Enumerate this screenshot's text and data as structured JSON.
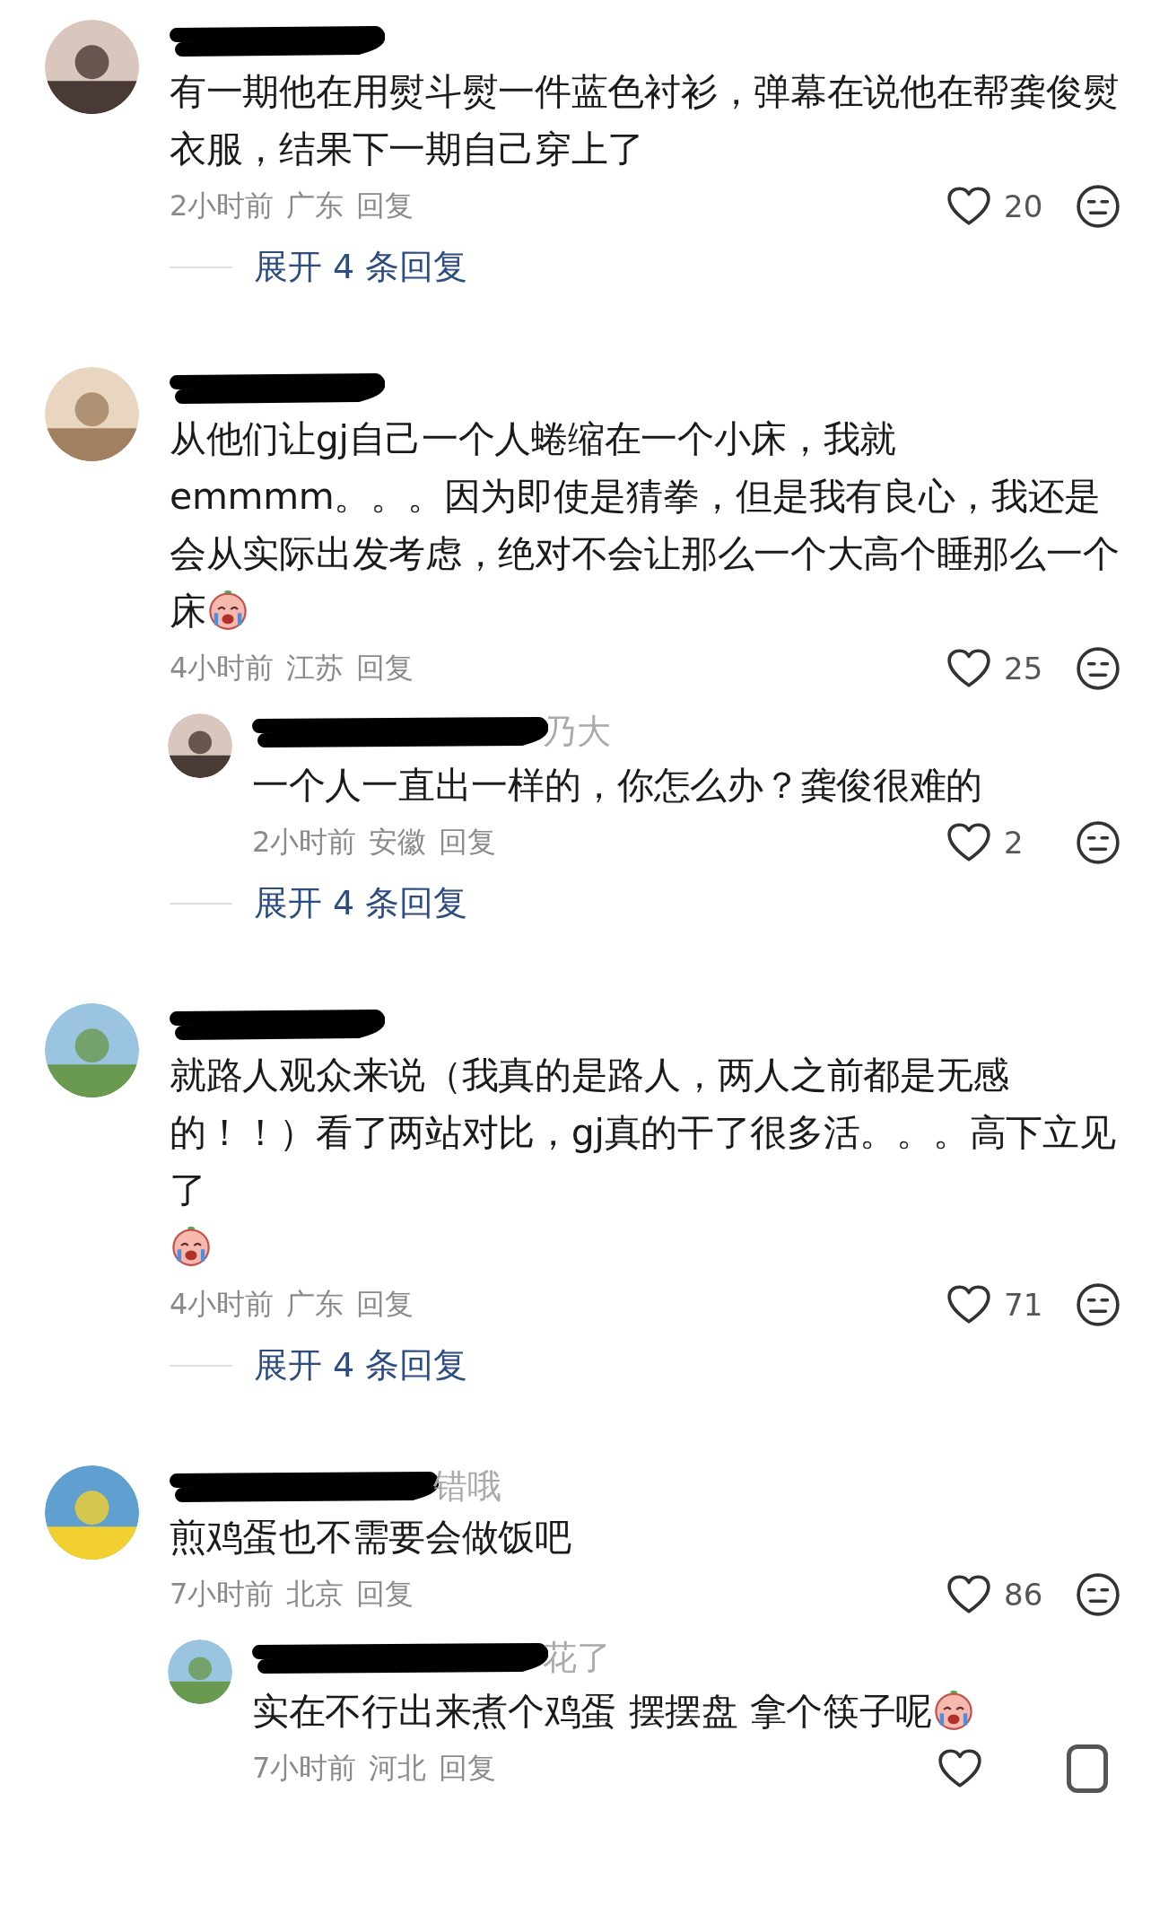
{
  "comments": [
    {
      "text": "有一期他在用熨斗熨一件蓝色衬衫，弹幕在说他在帮龚俊熨衣服，结果下一期自己穿上了",
      "time": "2小时前",
      "location": "广东",
      "reply_label": "回复",
      "likes": "20",
      "expand": "展开 4 条回复"
    },
    {
      "text": "从他们让gj自己一个人蜷缩在一个小床，我就emmmm。。。因为即使是猜拳，但是我有良心，我还是会从实际出发考虑，绝对不会让那么一个大高个睡那么一个床",
      "sticker": {
        "kind": "inline"
      },
      "time": "4小时前",
      "location": "江苏",
      "reply_label": "回复",
      "likes": "25",
      "replies": [
        {
          "name_fragment": "乃大",
          "text": "一个人一直出一样的，你怎么办？龚俊很难的",
          "time": "2小时前",
          "location": "安徽",
          "reply_label": "回复",
          "likes": "2"
        }
      ],
      "expand": "展开 4 条回复"
    },
    {
      "text": "就路人观众来说（我真的是路人，两人之前都是无感的！！）看了两站对比，gj真的干了很多活。。。高下立见了",
      "sticker": {
        "kind": "own_line"
      },
      "time": "4小时前",
      "location": "广东",
      "reply_label": "回复",
      "likes": "71",
      "expand": "展开 4 条回复"
    },
    {
      "name_fragment": "错哦",
      "text": "煎鸡蛋也不需要会做饭吧",
      "time": "7小时前",
      "location": "北京",
      "reply_label": "回复",
      "likes": "86",
      "replies": [
        {
          "name_fragment": "花了",
          "text": "实在不行出来煮个鸡蛋 摆摆盘 拿个筷子呢",
          "sticker": {
            "kind": "inline"
          },
          "time": "7小时前",
          "location": "河北",
          "reply_label": "回复",
          "cut": true
        }
      ]
    }
  ]
}
